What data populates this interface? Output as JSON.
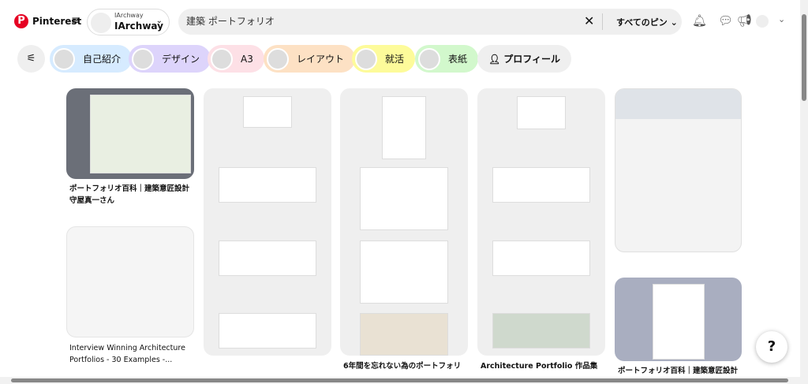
{
  "header": {
    "brand": "Pinterest",
    "account_small": "IArchway",
    "account_name": "IArchway",
    "search_value": "建築 ポートフォリオ",
    "scope": "すべてのピン ⌄"
  },
  "chips": [
    {
      "label": "自己紹介",
      "color": "#d6ebff"
    },
    {
      "label": "デザイン",
      "color": "#ddd4fb"
    },
    {
      "label": "A3",
      "color": "#fde0e6"
    },
    {
      "label": "レイアウト",
      "color": "#fde1c4"
    },
    {
      "label": "就活",
      "color": "#fdfb9a"
    },
    {
      "label": "表紙",
      "color": "#d2f8cc"
    }
  ],
  "profile_chip": "プロフィール",
  "pins": {
    "c1a": "ポートフォリオ百科｜建築意匠設計 守屋真一さん",
    "c1b": "Interview Winning Architecture Portfolios - 30 Examples -...",
    "c3": "6年間を忘れない為のポートフォリ",
    "c4": "Architecture Portfolio 作品集",
    "c5": "ポートフォリオ百科｜建築意匠設計"
  },
  "help": "?"
}
